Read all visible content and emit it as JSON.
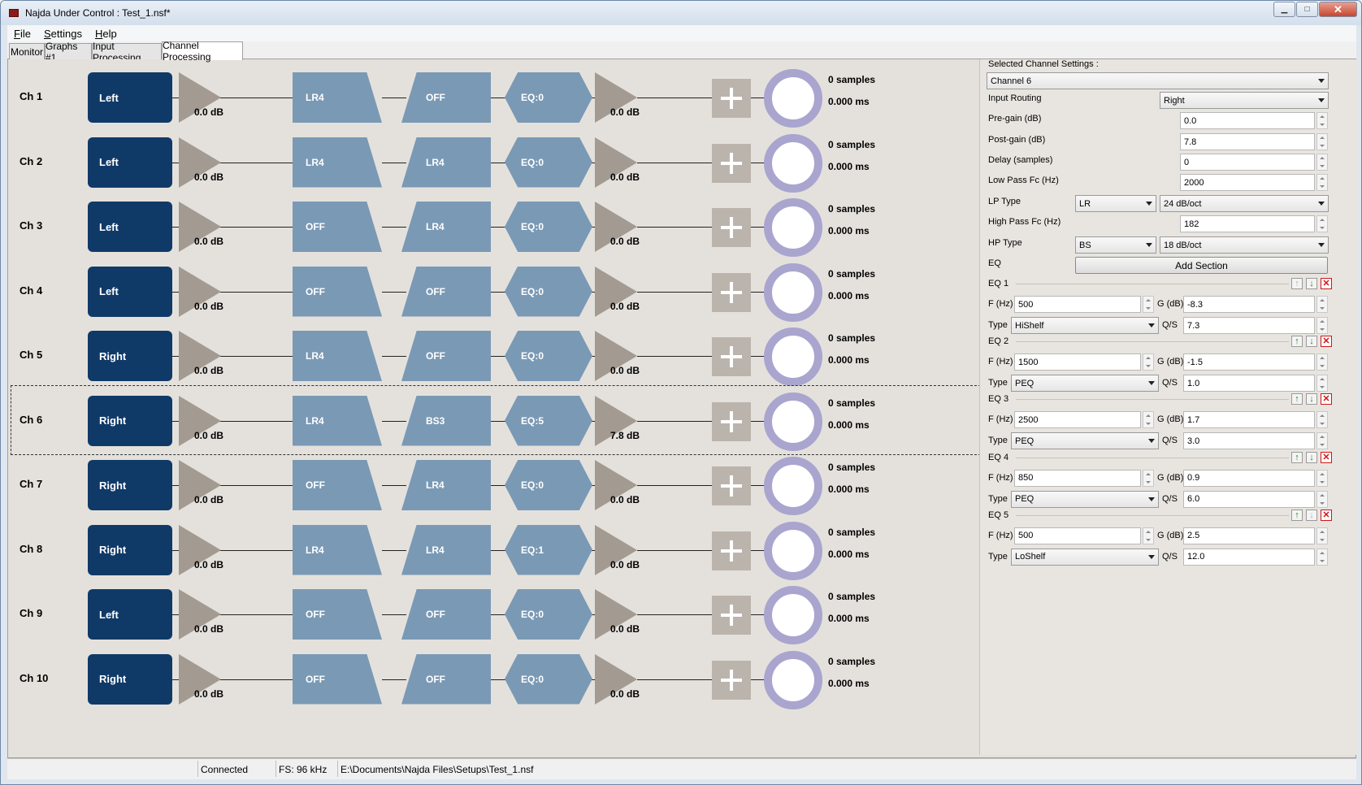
{
  "window": {
    "title": "Najda Under Control : Test_1.nsf*",
    "min_icon": "minimize-icon",
    "max_icon": "maximize-icon",
    "close_icon": "close-icon"
  },
  "menu": [
    {
      "accel": "F",
      "rest": "ile"
    },
    {
      "accel": "S",
      "rest": "ettings"
    },
    {
      "accel": "H",
      "rest": "elp"
    }
  ],
  "tabs": [
    "Monitor",
    "Graphs #1",
    "Input Processing",
    "Channel Processing"
  ],
  "channels": [
    {
      "label": "Ch 1",
      "routing": "Left",
      "pre_gain": "0.0 dB",
      "lp": "LR4",
      "hp": "OFF",
      "eq": "EQ:0",
      "post_gain": "0.0 dB",
      "delay_samples": "0 samples",
      "delay_ms": "0.000 ms",
      "selected": false
    },
    {
      "label": "Ch 2",
      "routing": "Left",
      "pre_gain": "0.0 dB",
      "lp": "LR4",
      "hp": "LR4",
      "eq": "EQ:0",
      "post_gain": "0.0 dB",
      "delay_samples": "0 samples",
      "delay_ms": "0.000 ms",
      "selected": false
    },
    {
      "label": "Ch 3",
      "routing": "Left",
      "pre_gain": "0.0 dB",
      "lp": "OFF",
      "hp": "LR4",
      "eq": "EQ:0",
      "post_gain": "0.0 dB",
      "delay_samples": "0 samples",
      "delay_ms": "0.000 ms",
      "selected": false
    },
    {
      "label": "Ch 4",
      "routing": "Left",
      "pre_gain": "0.0 dB",
      "lp": "OFF",
      "hp": "OFF",
      "eq": "EQ:0",
      "post_gain": "0.0 dB",
      "delay_samples": "0 samples",
      "delay_ms": "0.000 ms",
      "selected": false
    },
    {
      "label": "Ch 5",
      "routing": "Right",
      "pre_gain": "0.0 dB",
      "lp": "LR4",
      "hp": "OFF",
      "eq": "EQ:0",
      "post_gain": "0.0 dB",
      "delay_samples": "0 samples",
      "delay_ms": "0.000 ms",
      "selected": false
    },
    {
      "label": "Ch 6",
      "routing": "Right",
      "pre_gain": "0.0 dB",
      "lp": "LR4",
      "hp": "BS3",
      "eq": "EQ:5",
      "post_gain": "7.8 dB",
      "delay_samples": "0 samples",
      "delay_ms": "0.000 ms",
      "selected": true
    },
    {
      "label": "Ch 7",
      "routing": "Right",
      "pre_gain": "0.0 dB",
      "lp": "OFF",
      "hp": "LR4",
      "eq": "EQ:0",
      "post_gain": "0.0 dB",
      "delay_samples": "0 samples",
      "delay_ms": "0.000 ms",
      "selected": false
    },
    {
      "label": "Ch 8",
      "routing": "Right",
      "pre_gain": "0.0 dB",
      "lp": "LR4",
      "hp": "LR4",
      "eq": "EQ:1",
      "post_gain": "0.0 dB",
      "delay_samples": "0 samples",
      "delay_ms": "0.000 ms",
      "selected": false
    },
    {
      "label": "Ch 9",
      "routing": "Left",
      "pre_gain": "0.0 dB",
      "lp": "OFF",
      "hp": "OFF",
      "eq": "EQ:0",
      "post_gain": "0.0 dB",
      "delay_samples": "0 samples",
      "delay_ms": "0.000 ms",
      "selected": false
    },
    {
      "label": "Ch 10",
      "routing": "Right",
      "pre_gain": "0.0 dB",
      "lp": "OFF",
      "hp": "OFF",
      "eq": "EQ:0",
      "post_gain": "0.0 dB",
      "delay_samples": "0 samples",
      "delay_ms": "0.000 ms",
      "selected": false
    }
  ],
  "panel": {
    "title": "Selected Channel Settings :",
    "channel_select": "Channel 6",
    "input_routing_label": "Input Routing",
    "input_routing_value": "Right",
    "pre_gain_label": "Pre-gain (dB)",
    "pre_gain_value": "0.0",
    "post_gain_label": "Post-gain (dB)",
    "post_gain_value": "7.8",
    "delay_label": "Delay (samples)",
    "delay_value": "0",
    "lp_fc_label": "Low Pass Fc (Hz)",
    "lp_fc_value": "2000",
    "lp_type_label": "LP Type",
    "lp_type": "LR",
    "lp_slope": "24 dB/oct",
    "hp_fc_label": "High Pass Fc (Hz)",
    "hp_fc_value": "182",
    "hp_type_label": "HP Type",
    "hp_type": "BS",
    "hp_slope": "18 dB/oct",
    "eq_label": "EQ",
    "add_section": "Add Section",
    "f_label": "F (Hz)",
    "g_label": "G (dB)",
    "type_label": "Type",
    "qs_label": "Q/S",
    "eq_sections": [
      {
        "name": "EQ 1",
        "f": "500",
        "g": "-8.3",
        "type": "HiShelf",
        "qs": "7.3",
        "up_enabled": false,
        "down_enabled": true
      },
      {
        "name": "EQ 2",
        "f": "1500",
        "g": "-1.5",
        "type": "PEQ",
        "qs": "1.0",
        "up_enabled": true,
        "down_enabled": true
      },
      {
        "name": "EQ 3",
        "f": "2500",
        "g": "1.7",
        "type": "PEQ",
        "qs": "3.0",
        "up_enabled": true,
        "down_enabled": true
      },
      {
        "name": "EQ 4",
        "f": "850",
        "g": "0.9",
        "type": "PEQ",
        "qs": "6.0",
        "up_enabled": true,
        "down_enabled": true
      },
      {
        "name": "EQ 5",
        "f": "500",
        "g": "2.5",
        "type": "LoShelf",
        "qs": "12.0",
        "up_enabled": true,
        "down_enabled": false
      }
    ]
  },
  "status": {
    "connection": "Connected",
    "fs": "FS: 96 kHz",
    "path": "E:\\Documents\\Najda Files\\Setups\\Test_1.nsf"
  },
  "colors": {
    "routing": "#0f3a68",
    "filter": "#7a99b5",
    "gain": "#a39a92",
    "delay_ring": "#a9a5cf",
    "add": "#bbb4ad"
  }
}
